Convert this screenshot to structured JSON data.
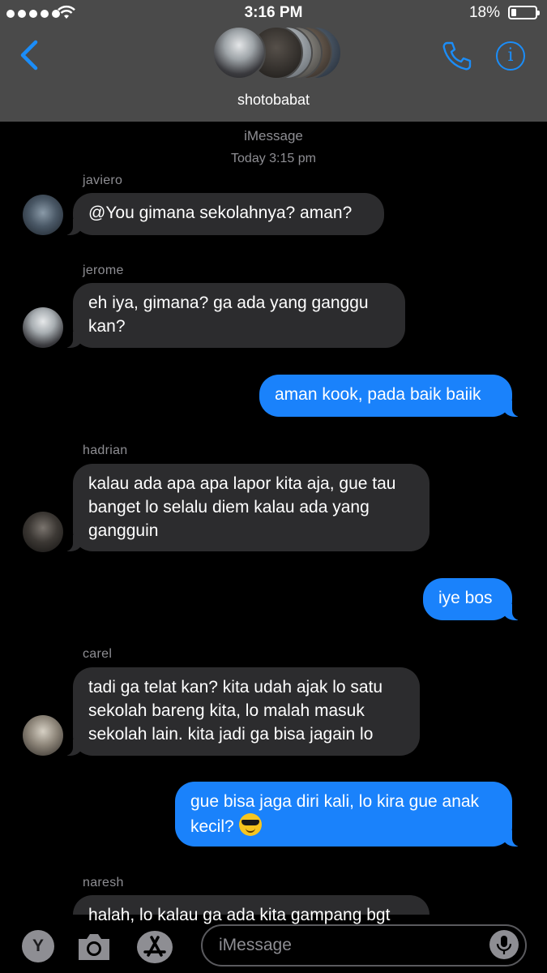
{
  "status_bar": {
    "time": "3:16 PM",
    "battery": "18%",
    "battery_level": 0.18,
    "signal_bars": 5
  },
  "header": {
    "group_name": "shotobabat"
  },
  "thread": {
    "service": "iMessage",
    "timestamp": "Today 3:15 pm"
  },
  "messages": [
    {
      "sender": "javiero",
      "text": "@You gimana sekolahnya? aman?",
      "direction": "incoming"
    },
    {
      "sender": "jerome",
      "text": "eh iya, gimana? ga ada yang ganggu kan?",
      "direction": "incoming"
    },
    {
      "text": "aman kook, pada baik baiik",
      "direction": "outgoing"
    },
    {
      "sender": "hadrian",
      "text": "kalau ada apa apa lapor kita aja, gue tau banget lo selalu diem kalau ada yang gangguin",
      "direction": "incoming"
    },
    {
      "text": "iye bos",
      "direction": "outgoing"
    },
    {
      "sender": "carel",
      "text": "tadi ga telat kan? kita udah ajak lo satu sekolah bareng kita, lo malah masuk sekolah lain. kita jadi ga bisa jagain lo",
      "direction": "incoming"
    },
    {
      "text": "gue bisa jaga diri kali, lo kira gue anak kecil?",
      "emoji": "sunglasses-emoji",
      "direction": "outgoing"
    },
    {
      "sender": "naresh",
      "text": "halah, lo kalau ga ada kita gampang bgt",
      "direction": "incoming"
    }
  ],
  "input": {
    "placeholder": "iMessage",
    "y_button": "Y"
  },
  "colors": {
    "header_bg": "#4a4a4a",
    "accent": "#1b8df8",
    "outgoing_bubble": "#1a82fb",
    "incoming_bubble": "#2c2c2e",
    "meta_text": "#8e8e93"
  },
  "icons": [
    "back-chevron-icon",
    "phone-icon",
    "info-icon",
    "camera-icon",
    "app-store-icon",
    "microphone-icon",
    "wifi-icon",
    "battery-icon"
  ]
}
